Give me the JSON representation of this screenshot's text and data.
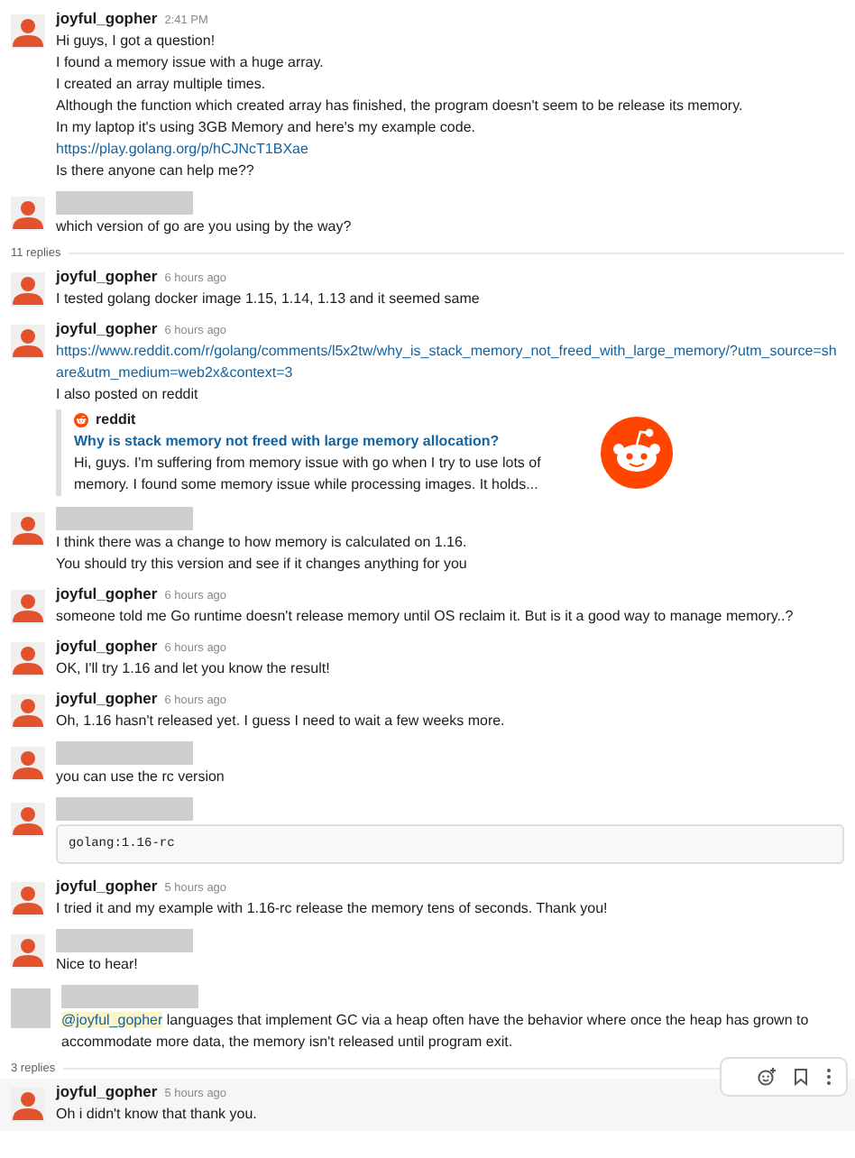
{
  "thread": [
    {
      "kind": "message",
      "avatar": {
        "kind": "person"
      },
      "author": "joyful_gopher",
      "name_redacted": false,
      "time": "2:41 PM",
      "hovered": false,
      "body": [
        {
          "kind": "text",
          "text": "Hi guys, I got a question!"
        },
        {
          "kind": "text",
          "text": "I found a memory issue with a huge array."
        },
        {
          "kind": "text",
          "text": "I created an array multiple times."
        },
        {
          "kind": "text",
          "text": "Although the function which created array has finished, the program doesn't seem to be release its memory."
        },
        {
          "kind": "text",
          "text": "In my laptop it's using 3GB Memory and here's my example code."
        },
        {
          "kind": "link",
          "text": "https://play.golang.org/p/hCJNcT1BXae"
        },
        {
          "kind": "text",
          "text": "Is there anyone can help me??"
        }
      ]
    },
    {
      "kind": "message",
      "avatar": {
        "kind": "person"
      },
      "name_redacted": true,
      "hovered": false,
      "body": [
        {
          "kind": "text",
          "text": "which version of go are you using by the way?"
        }
      ]
    },
    {
      "kind": "divider",
      "label": "11 replies"
    },
    {
      "kind": "message",
      "avatar": {
        "kind": "person"
      },
      "author": "joyful_gopher",
      "name_redacted": false,
      "time": "6 hours ago",
      "hovered": false,
      "body": [
        {
          "kind": "text",
          "text": "I tested golang docker image 1.15, 1.14, 1.13 and it seemed same"
        }
      ]
    },
    {
      "kind": "message",
      "avatar": {
        "kind": "person"
      },
      "author": "joyful_gopher",
      "name_redacted": false,
      "time": "6 hours ago",
      "hovered": false,
      "body": [
        {
          "kind": "link",
          "text": "https://www.reddit.com/r/golang/comments/l5x2tw/why_is_stack_memory_not_freed_with_large_memory/?utm_source=share&utm_medium=web2x&context=3"
        },
        {
          "kind": "text",
          "text": "I also posted on reddit"
        },
        {
          "kind": "embed",
          "site": "reddit",
          "title": "Why is stack memory not freed with large memory allocation?",
          "description": "Hi, guys. I'm suffering from memory issue with go when I try to use lots of memory. I found some memory issue while processing images. It holds..."
        }
      ]
    },
    {
      "kind": "message",
      "avatar": {
        "kind": "person"
      },
      "name_redacted": true,
      "hovered": false,
      "body": [
        {
          "kind": "text",
          "text": "I think there was a change to how memory is calculated on 1.16."
        },
        {
          "kind": "text",
          "text": "You should try this version and see if it changes anything for you"
        }
      ]
    },
    {
      "kind": "message",
      "avatar": {
        "kind": "person"
      },
      "author": "joyful_gopher",
      "name_redacted": false,
      "time": "6 hours ago",
      "hovered": false,
      "body": [
        {
          "kind": "text",
          "text": "someone told me Go runtime doesn't release memory until OS reclaim it. But is it a good way to manage memory..?"
        }
      ]
    },
    {
      "kind": "message",
      "avatar": {
        "kind": "person"
      },
      "author": "joyful_gopher",
      "name_redacted": false,
      "time": "6 hours ago",
      "hovered": false,
      "body": [
        {
          "kind": "text",
          "text": "OK, I'll try 1.16 and let you know the result!"
        }
      ]
    },
    {
      "kind": "message",
      "avatar": {
        "kind": "person"
      },
      "author": "joyful_gopher",
      "name_redacted": false,
      "time": "6 hours ago",
      "hovered": false,
      "body": [
        {
          "kind": "text",
          "text": "Oh, 1.16 hasn't released yet. I guess I need to wait a few weeks more."
        }
      ]
    },
    {
      "kind": "message",
      "avatar": {
        "kind": "person"
      },
      "name_redacted": true,
      "hovered": false,
      "body": [
        {
          "kind": "text",
          "text": "you can use the rc version"
        }
      ]
    },
    {
      "kind": "message",
      "avatar": {
        "kind": "person"
      },
      "name_redacted": true,
      "hovered": false,
      "body": [
        {
          "kind": "code",
          "text": "golang:1.16-rc"
        }
      ]
    },
    {
      "kind": "message",
      "avatar": {
        "kind": "person"
      },
      "author": "joyful_gopher",
      "name_redacted": false,
      "time": "5 hours ago",
      "hovered": false,
      "body": [
        {
          "kind": "text",
          "text": "I tried it and my example with 1.16-rc release the memory tens of seconds. Thank you!"
        }
      ]
    },
    {
      "kind": "message",
      "avatar": {
        "kind": "person"
      },
      "name_redacted": true,
      "hovered": false,
      "body": [
        {
          "kind": "text",
          "text": "Nice to hear!"
        }
      ]
    },
    {
      "kind": "message",
      "avatar": {
        "kind": "blank"
      },
      "name_redacted": true,
      "hovered": false,
      "body": [
        {
          "kind": "mention",
          "mention": "@joyful_gopher",
          "text": "languages that implement GC via a heap often have the behavior where once the heap has grown to accommodate more data, the memory isn't released until program exit."
        }
      ]
    },
    {
      "kind": "divider",
      "label": "3 replies"
    },
    {
      "kind": "message",
      "avatar": {
        "kind": "person"
      },
      "author": "joyful_gopher",
      "name_redacted": false,
      "time": "5 hours ago",
      "hovered": true,
      "body": [
        {
          "kind": "text",
          "text": "Oh i didn't know that thank you."
        }
      ]
    }
  ]
}
